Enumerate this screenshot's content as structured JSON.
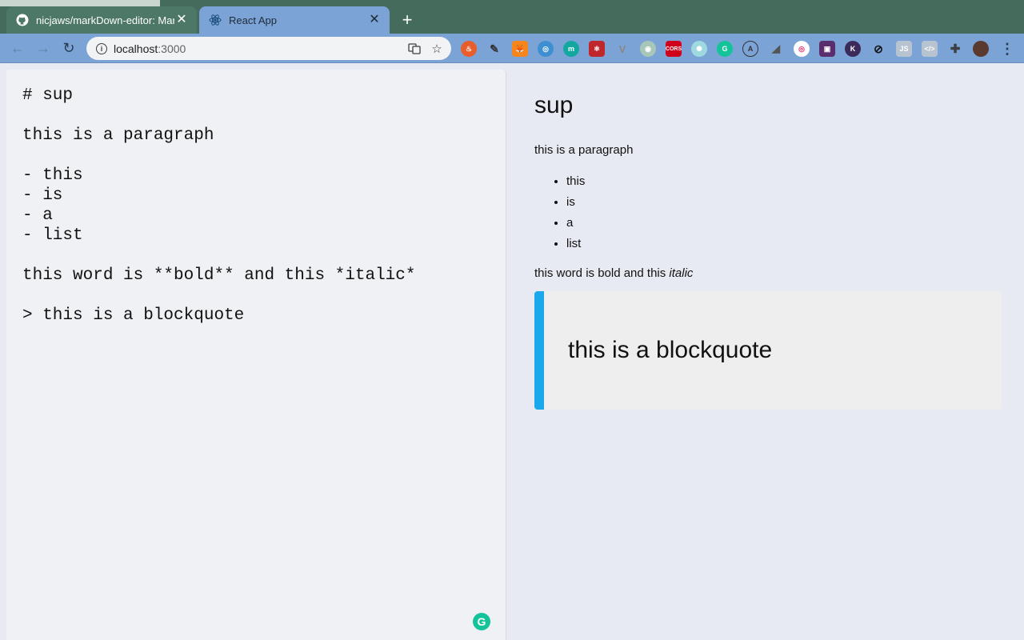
{
  "browser": {
    "tabs": [
      {
        "title": "nicjaws/markDown-editor: Mar",
        "favicon": "github-icon"
      },
      {
        "title": "React App",
        "favicon": "react-icon"
      }
    ],
    "new_tab": "+",
    "url_host": "localhost",
    "url_port": ":3000",
    "extensions": [
      "fire",
      "eyedropper",
      "metamask",
      "compass",
      "m",
      "react-dev",
      "vue",
      "circle",
      "CORS",
      "sync",
      "grammarly",
      "A",
      "chart",
      "instagram",
      "box",
      "K",
      "link",
      "JS",
      "code",
      "puzzle",
      "avatar"
    ]
  },
  "editor": {
    "source": "# sup\n\nthis is a paragraph\n\n- this\n- is\n- a\n- list\n\nthis word is **bold** and this *italic*\n\n> this is a blockquote"
  },
  "preview": {
    "heading": "sup",
    "paragraph": "this is a paragraph",
    "list": [
      "this",
      "is",
      "a",
      "list"
    ],
    "mixed_text_before": "this word is bold and this ",
    "mixed_text_italic": "italic",
    "blockquote": "this is a blockquote"
  },
  "colors": {
    "accent": "#1aa7ec",
    "tabstrip": "#456b5c",
    "toolbar": "#7ba3d6",
    "grammarly": "#15c39a"
  }
}
